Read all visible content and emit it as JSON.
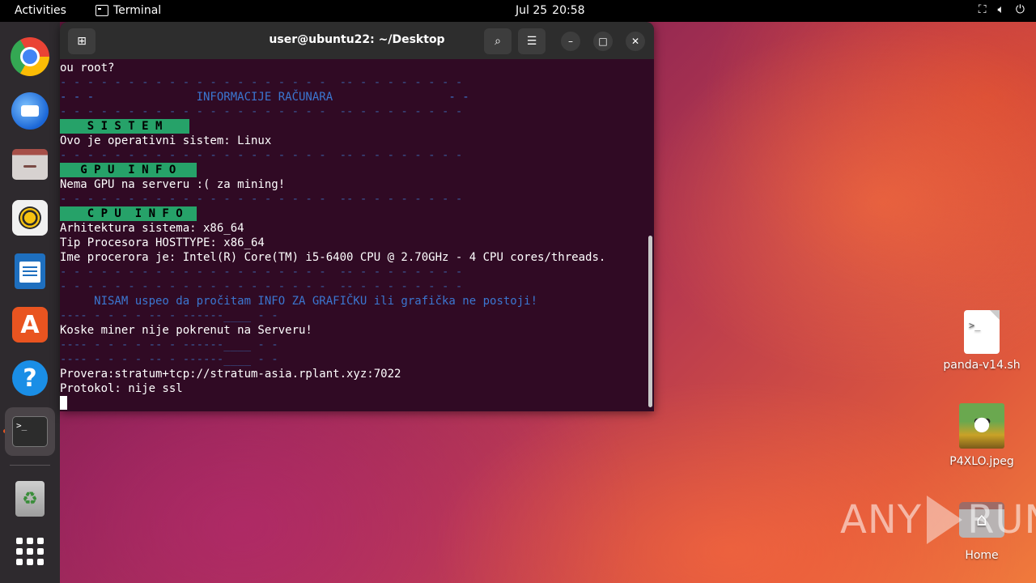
{
  "topbar": {
    "activities": "Activities",
    "app_name": "Terminal",
    "date": "Jul 25",
    "time": "20:58",
    "tray": [
      "network-icon",
      "volume-icon",
      "power-icon"
    ]
  },
  "dock": {
    "items": [
      "chrome-icon",
      "thunderbird-icon",
      "files-icon",
      "rhythmbox-icon",
      "writer-icon",
      "software-icon",
      "help-icon",
      "terminal-icon",
      "trash-icon",
      "app-grid-icon"
    ]
  },
  "terminal": {
    "title": "user@ubuntu22: ~/Desktop",
    "lines": [
      {
        "text": "ou root?",
        "style": "normal"
      },
      {
        "text": "- - - - - - - - - - - - - - - - - - - -  -- - - - - - - - -",
        "style": "dash"
      },
      {
        "text": "- - -               INFORMACIJE RAČUNARA                 - -",
        "style": "info"
      },
      {
        "text": "- - - - - - - - - - - - - - - - - - - -  -- - - - - - - - -",
        "style": "dash"
      },
      {
        "text": "    S I S T E M    ",
        "style": "hl"
      },
      {
        "text": "Ovo je operativni sistem: Linux",
        "style": "normal"
      },
      {
        "text": "- - - - - - - - - - - - - - - - - - - -  -- - - - - - - - -",
        "style": "dash"
      },
      {
        "text": "   G P U  I N F O   ",
        "style": "hl"
      },
      {
        "text": "Nema GPU na serveru :( za mining!",
        "style": "normal"
      },
      {
        "text": "- - - - - - - - - - - - - - - - - - - -  -- - - - - - - - -",
        "style": "dash"
      },
      {
        "text": "    C P U  I N F O  ",
        "style": "hl"
      },
      {
        "text": "Arhitektura sistema: x86_64",
        "style": "normal"
      },
      {
        "text": "Tip Procesora HOSTTYPE: x86_64",
        "style": "normal"
      },
      {
        "text": "Ime procerora je: Intel(R) Core(TM) i5-6400 CPU @ 2.70GHz - 4 CPU cores/threads.",
        "style": "normal"
      },
      {
        "text": "- - - - - - - - - - - - - - - - - - - -  -- - - - - - - - -",
        "style": "dash"
      },
      {
        "text": "- - - - - - - - - - - - - - - - - - - -  -- - - - - - - - -",
        "style": "dash"
      },
      {
        "text": "     NISAM uspeo da pročitam INFO ZA GRAFIČKU ili grafička ne postoji!",
        "style": "info"
      },
      {
        "text": "---- - - - - -- - ------____ - -",
        "style": "dash"
      },
      {
        "text": "Koske miner nije pokrenut na Serveru!",
        "style": "normal"
      },
      {
        "text": "---- - - - - -- - ------____ - -",
        "style": "dash"
      },
      {
        "text": "---- - - - - -- - ------____ - -",
        "style": "dash"
      },
      {
        "text": "Provera:stratum+tcp://stratum-asia.rplant.xyz:7022",
        "style": "normal"
      },
      {
        "text": "Protokol: nije ssl",
        "style": "normal"
      }
    ]
  },
  "desktop": {
    "icons": [
      {
        "label": "panda-v14.sh",
        "icon": "script-file-icon"
      },
      {
        "label": "P4XLO.jpeg",
        "icon": "image-file-icon"
      },
      {
        "label": "Home",
        "icon": "home-folder-icon"
      }
    ]
  },
  "watermark": {
    "left": "ANY",
    "right": "RUN"
  }
}
